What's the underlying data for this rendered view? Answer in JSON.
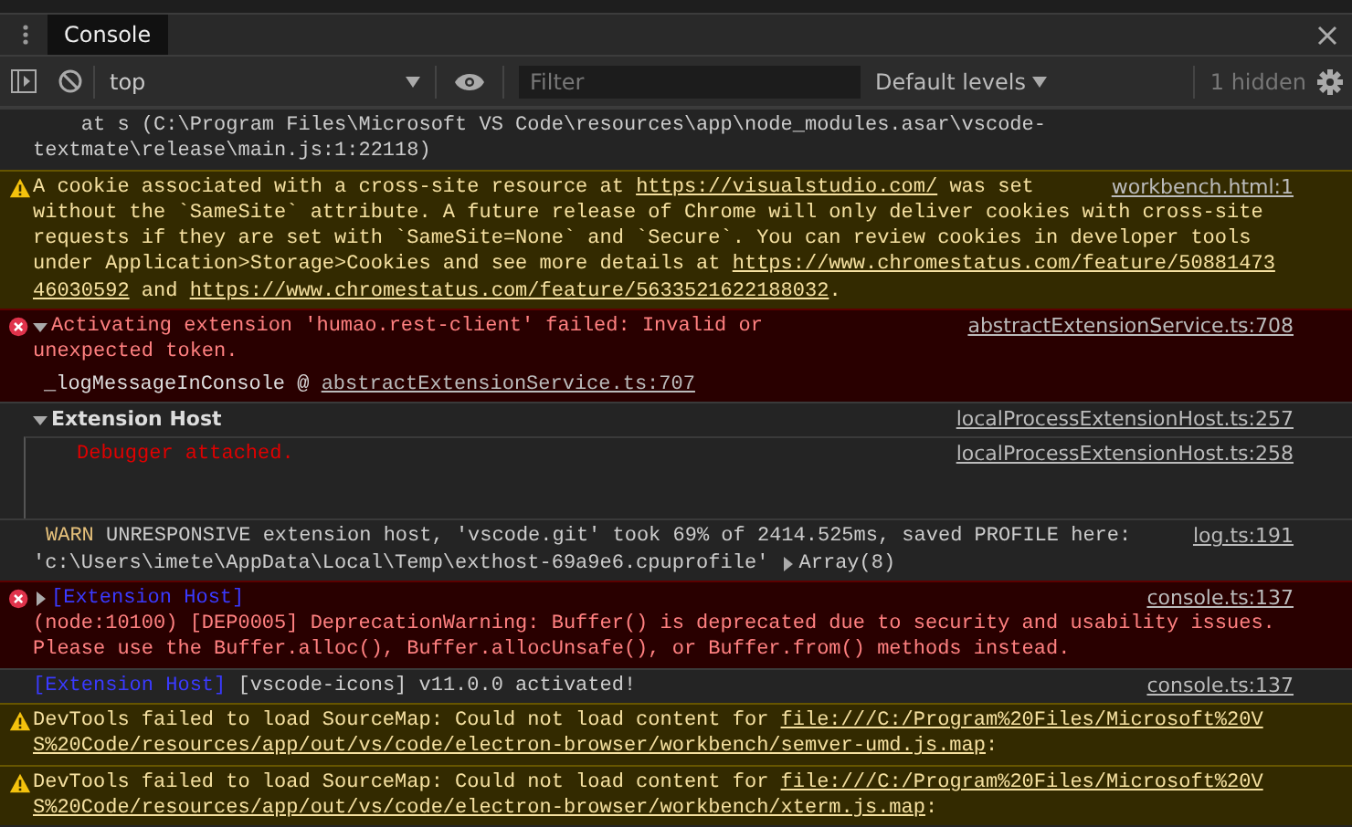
{
  "drawer_tabs": [
    {
      "label": "Console",
      "selected": true
    }
  ],
  "toolbar": {
    "context": "top",
    "filter": {
      "placeholder": "Filter"
    },
    "levels": "Default levels",
    "hidden_count": "1 hidden"
  },
  "messages": [
    {
      "kind": "plain",
      "lines": [
        [
          {
            "kind": "text",
            "text": "    at s (C:\\Program Files\\Microsoft VS Code\\resources\\app\\node_modules.asar\\vscode-"
          }
        ],
        [
          {
            "kind": "text",
            "text": "textmate\\release\\main.js:1:22118)"
          }
        ]
      ]
    },
    {
      "kind": "warning",
      "source": "workbench.html:1",
      "lines": [
        [
          {
            "kind": "text",
            "text": "A cookie associated with a cross-site resource at "
          },
          {
            "kind": "link",
            "text": "https://visualstudio.com/"
          },
          {
            "kind": "text",
            "text": " was set"
          }
        ],
        [
          {
            "kind": "text",
            "text": "without the `SameSite` attribute. A future release of Chrome will only deliver cookies with cross-site"
          }
        ],
        [
          {
            "kind": "text",
            "text": "requests if they are set with `SameSite=None` and `Secure`. You can review cookies in developer tools"
          }
        ],
        [
          {
            "kind": "text",
            "text": "under Application>Storage>Cookies and see more details at "
          },
          {
            "kind": "link",
            "text": "https://www.chromestatus.com/feature/50881473"
          }
        ],
        [
          {
            "kind": "link",
            "text": "46030592"
          },
          {
            "kind": "text",
            "text": " and "
          },
          {
            "kind": "link",
            "text": "https://www.chromestatus.com/feature/5633521622188032"
          },
          {
            "kind": "text",
            "text": "."
          }
        ]
      ]
    },
    {
      "kind": "error",
      "expanded": true,
      "source": "abstractExtensionService.ts:708",
      "lines": [
        [
          {
            "kind": "text",
            "text": "Activating extension 'humao.rest-client' failed: Invalid or"
          }
        ],
        [
          {
            "kind": "text",
            "text": "unexpected token."
          }
        ]
      ],
      "stack": [
        {
          "function": "_logMessageInConsole @ ",
          "link": "abstractExtensionService.ts:707"
        }
      ]
    },
    {
      "kind": "group",
      "expanded": true,
      "source": "localProcessExtensionHost.ts:257",
      "lines": [
        [
          {
            "kind": "text",
            "text": "Extension Host"
          }
        ]
      ],
      "children": [
        {
          "source": "localProcessExtensionHost.ts:258",
          "lines": [
            [
              {
                "kind": "highlight",
                "text": "Debugger attached."
              }
            ]
          ]
        }
      ]
    },
    {
      "kind": "plain",
      "source": "log.ts:191",
      "lines": [
        [
          {
            "kind": "label",
            "text": "WARN"
          },
          {
            "kind": "text",
            "text": " UNRESPONSIVE extension host, 'vscode.git' took 69% of 2414.525ms, saved PROFILE here:"
          }
        ],
        [
          {
            "kind": "text",
            "text": "'c:\\Users\\imete\\AppData\\Local\\Temp\\exthost-69a9e6.cpuprofile' "
          },
          {
            "kind": "object",
            "text": "Array(8)",
            "expanded": false
          }
        ]
      ]
    },
    {
      "kind": "error",
      "expanded": false,
      "source": "console.ts:137",
      "lines": [
        [
          {
            "kind": "tag",
            "text": "[Extension Host]"
          }
        ],
        [
          {
            "kind": "text",
            "text": "(node:10100) [DEP0005] DeprecationWarning: Buffer() is deprecated due to security and usability issues."
          }
        ],
        [
          {
            "kind": "text",
            "text": "Please use the Buffer.alloc(), Buffer.allocUnsafe(), or Buffer.from() methods instead."
          }
        ]
      ]
    },
    {
      "kind": "plain",
      "source": "console.ts:137",
      "lines": [
        [
          {
            "kind": "tag",
            "text": "[Extension Host]"
          },
          {
            "kind": "text",
            "text": " [vscode-icons] v11.0.0 activated!"
          }
        ]
      ]
    },
    {
      "kind": "warning",
      "lines": [
        [
          {
            "kind": "text",
            "text": "DevTools failed to load SourceMap: Could not load content for "
          },
          {
            "kind": "link",
            "text": "file:///C:/Program%20Files/Microsoft%20V"
          }
        ],
        [
          {
            "kind": "link",
            "text": "S%20Code/resources/app/out/vs/code/electron-browser/workbench/semver-umd.js.map"
          },
          {
            "kind": "text",
            "text": ":"
          }
        ]
      ]
    },
    {
      "kind": "warning",
      "lines": [
        [
          {
            "kind": "text",
            "text": "DevTools failed to load SourceMap: Could not load content for "
          },
          {
            "kind": "link",
            "text": "file:///C:/Program%20Files/Microsoft%20V"
          }
        ],
        [
          {
            "kind": "link",
            "text": "S%20Code/resources/app/out/vs/code/electron-browser/workbench/xterm.js.map"
          },
          {
            "kind": "text",
            "text": ":"
          }
        ]
      ]
    }
  ]
}
